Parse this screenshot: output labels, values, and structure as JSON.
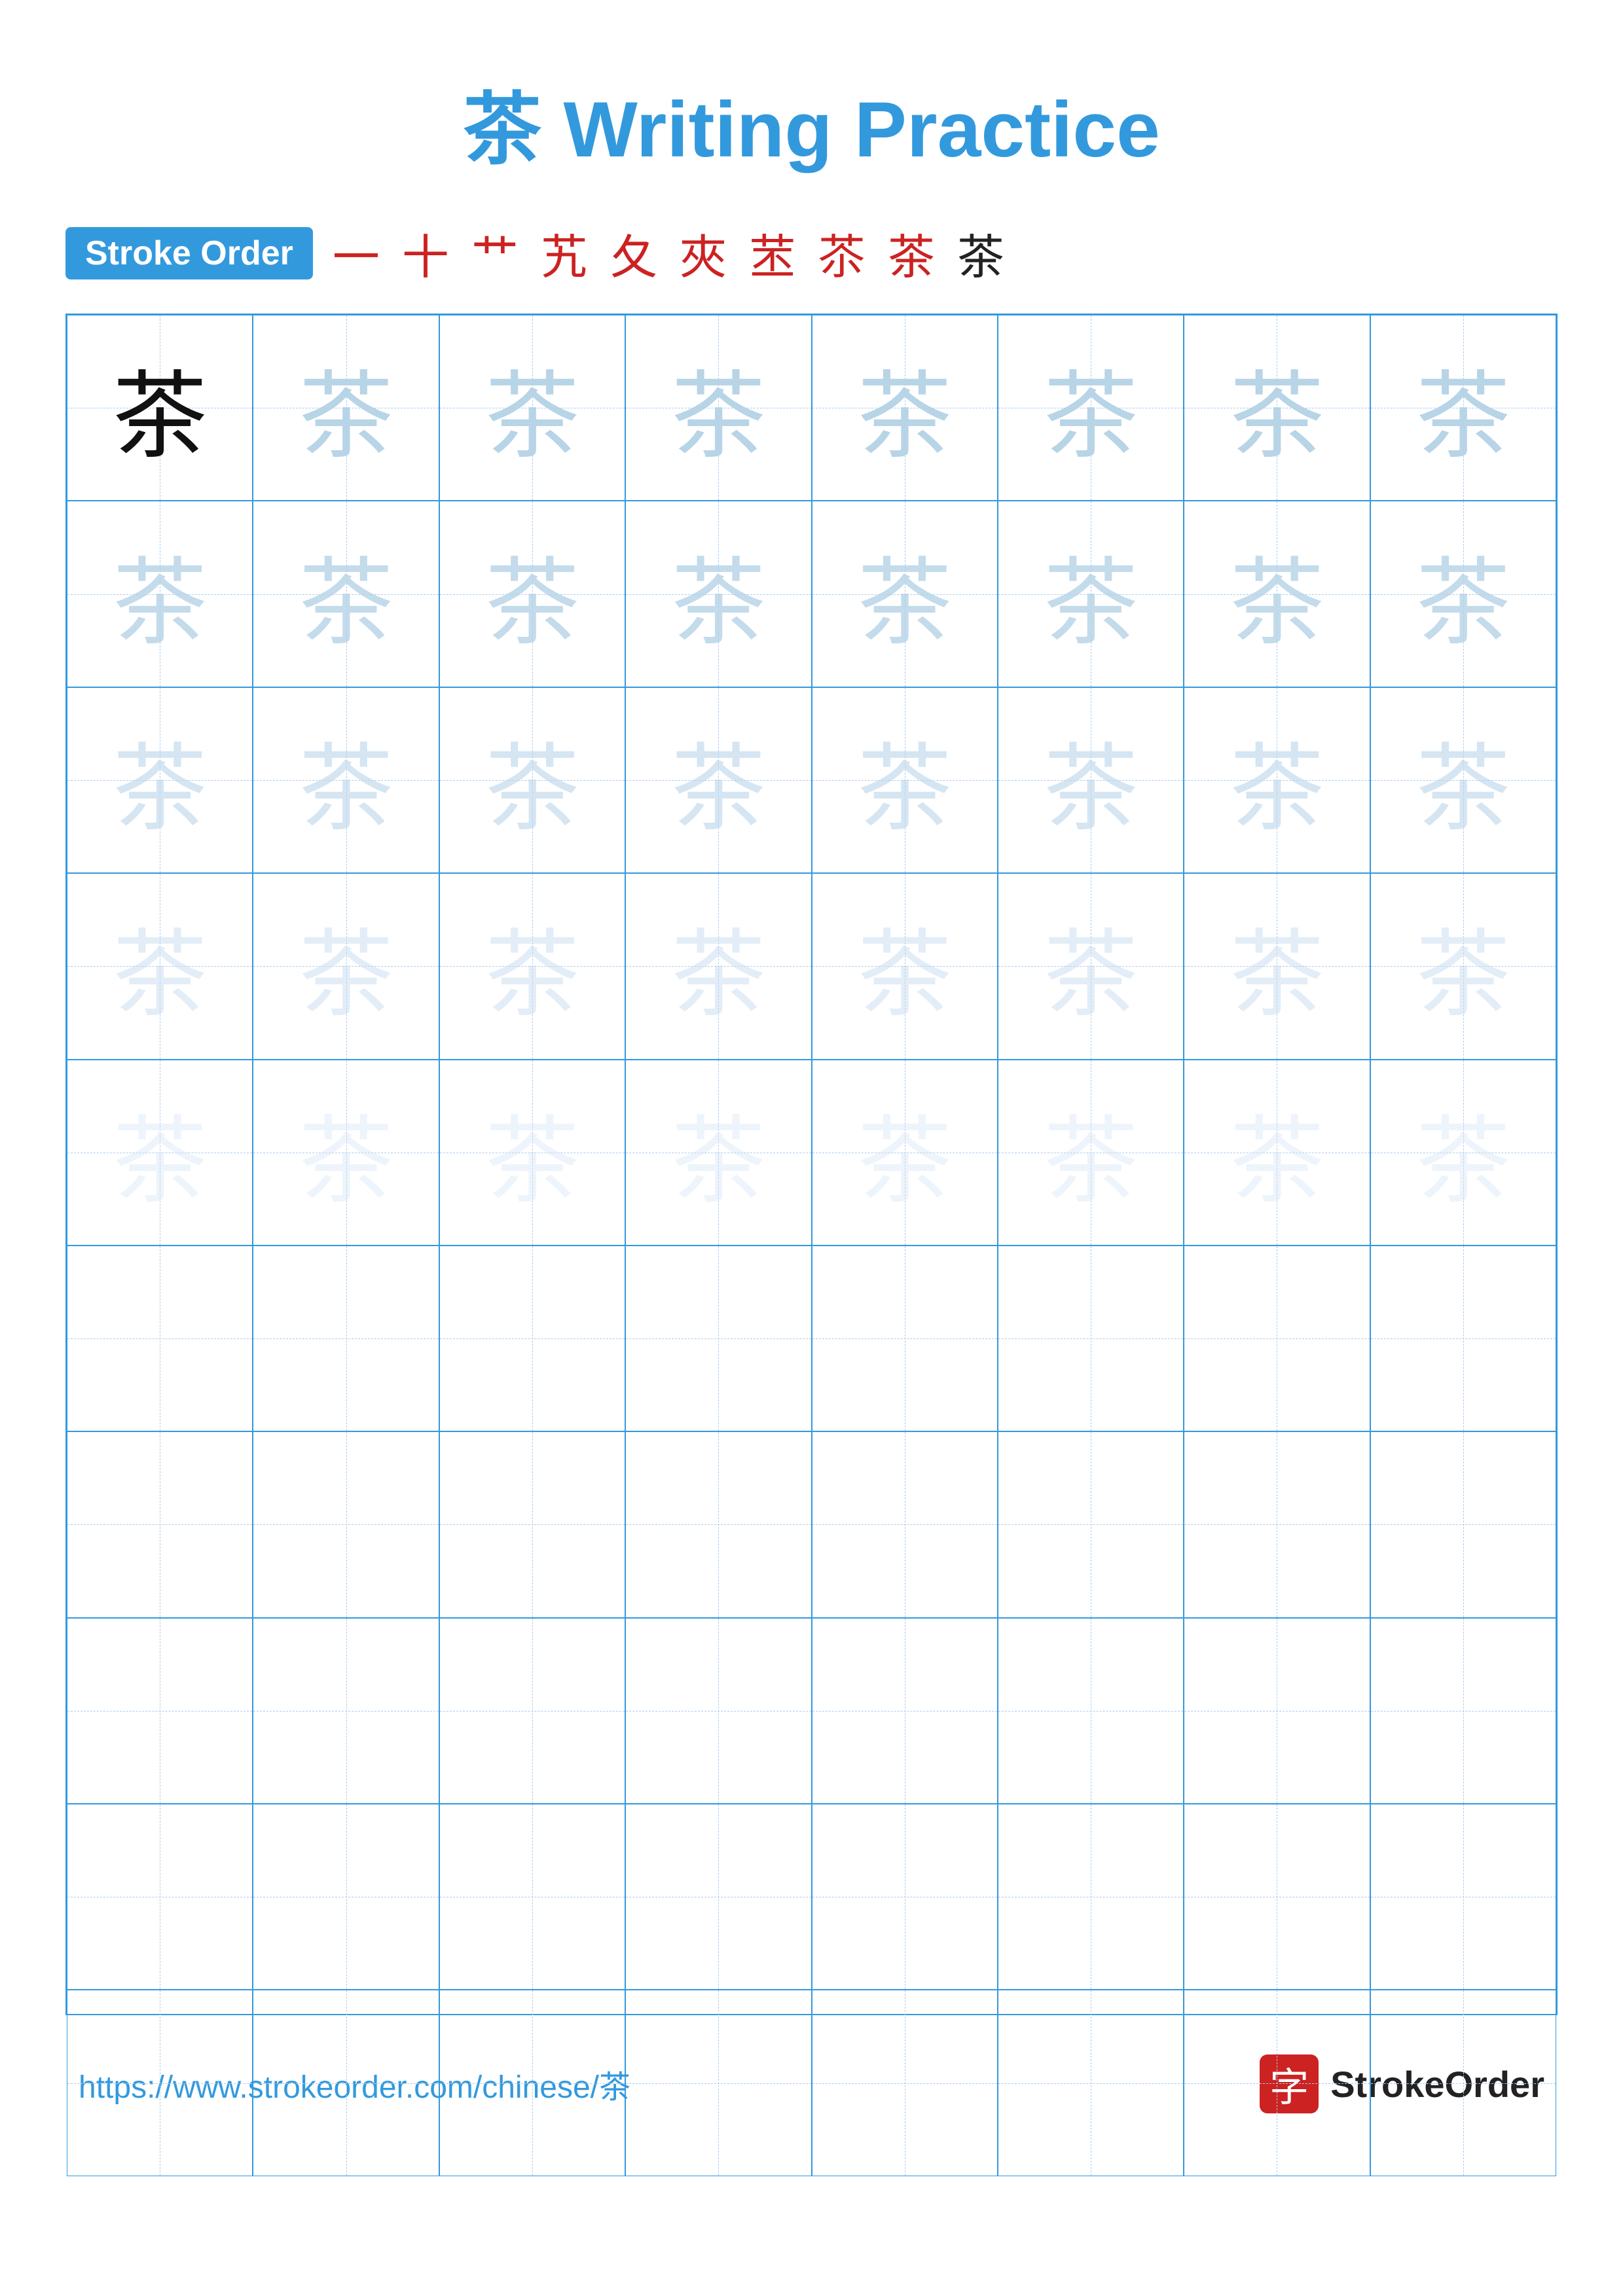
{
  "page": {
    "title": "茶 Writing Practice",
    "character": "茶",
    "stroke_order_label": "Stroke Order",
    "stroke_sequence": [
      "一",
      "十",
      "艹",
      "艽",
      "夂",
      "夾",
      "苤",
      "苶",
      "茶",
      "茶"
    ],
    "stroke_sequence_black_index": 9,
    "footer_url": "https://www.strokeorder.com/chinese/茶",
    "brand_name": "StrokeOrder",
    "brand_char": "字",
    "grid": {
      "cols": 8,
      "rows": 10,
      "cells": [
        {
          "row": 0,
          "col": 0,
          "char": "茶",
          "opacity": "solid"
        },
        {
          "row": 0,
          "col": 1,
          "char": "茶",
          "opacity": "1"
        },
        {
          "row": 0,
          "col": 2,
          "char": "茶",
          "opacity": "1"
        },
        {
          "row": 0,
          "col": 3,
          "char": "茶",
          "opacity": "1"
        },
        {
          "row": 0,
          "col": 4,
          "char": "茶",
          "opacity": "1"
        },
        {
          "row": 0,
          "col": 5,
          "char": "茶",
          "opacity": "1"
        },
        {
          "row": 0,
          "col": 6,
          "char": "茶",
          "opacity": "1"
        },
        {
          "row": 0,
          "col": 7,
          "char": "茶",
          "opacity": "1"
        },
        {
          "row": 1,
          "col": 0,
          "char": "茶",
          "opacity": "2"
        },
        {
          "row": 1,
          "col": 1,
          "char": "茶",
          "opacity": "2"
        },
        {
          "row": 1,
          "col": 2,
          "char": "茶",
          "opacity": "2"
        },
        {
          "row": 1,
          "col": 3,
          "char": "茶",
          "opacity": "2"
        },
        {
          "row": 1,
          "col": 4,
          "char": "茶",
          "opacity": "2"
        },
        {
          "row": 1,
          "col": 5,
          "char": "茶",
          "opacity": "2"
        },
        {
          "row": 1,
          "col": 6,
          "char": "茶",
          "opacity": "2"
        },
        {
          "row": 1,
          "col": 7,
          "char": "茶",
          "opacity": "2"
        },
        {
          "row": 2,
          "col": 0,
          "char": "茶",
          "opacity": "3"
        },
        {
          "row": 2,
          "col": 1,
          "char": "茶",
          "opacity": "3"
        },
        {
          "row": 2,
          "col": 2,
          "char": "茶",
          "opacity": "3"
        },
        {
          "row": 2,
          "col": 3,
          "char": "茶",
          "opacity": "3"
        },
        {
          "row": 2,
          "col": 4,
          "char": "茶",
          "opacity": "3"
        },
        {
          "row": 2,
          "col": 5,
          "char": "茶",
          "opacity": "3"
        },
        {
          "row": 2,
          "col": 6,
          "char": "茶",
          "opacity": "3"
        },
        {
          "row": 2,
          "col": 7,
          "char": "茶",
          "opacity": "3"
        },
        {
          "row": 3,
          "col": 0,
          "char": "茶",
          "opacity": "4"
        },
        {
          "row": 3,
          "col": 1,
          "char": "茶",
          "opacity": "4"
        },
        {
          "row": 3,
          "col": 2,
          "char": "茶",
          "opacity": "4"
        },
        {
          "row": 3,
          "col": 3,
          "char": "茶",
          "opacity": "4"
        },
        {
          "row": 3,
          "col": 4,
          "char": "茶",
          "opacity": "4"
        },
        {
          "row": 3,
          "col": 5,
          "char": "茶",
          "opacity": "4"
        },
        {
          "row": 3,
          "col": 6,
          "char": "茶",
          "opacity": "4"
        },
        {
          "row": 3,
          "col": 7,
          "char": "茶",
          "opacity": "4"
        },
        {
          "row": 4,
          "col": 0,
          "char": "茶",
          "opacity": "5"
        },
        {
          "row": 4,
          "col": 1,
          "char": "茶",
          "opacity": "5"
        },
        {
          "row": 4,
          "col": 2,
          "char": "茶",
          "opacity": "5"
        },
        {
          "row": 4,
          "col": 3,
          "char": "茶",
          "opacity": "5"
        },
        {
          "row": 4,
          "col": 4,
          "char": "茶",
          "opacity": "5"
        },
        {
          "row": 4,
          "col": 5,
          "char": "茶",
          "opacity": "5"
        },
        {
          "row": 4,
          "col": 6,
          "char": "茶",
          "opacity": "5"
        },
        {
          "row": 4,
          "col": 7,
          "char": "茶",
          "opacity": "5"
        }
      ]
    }
  }
}
